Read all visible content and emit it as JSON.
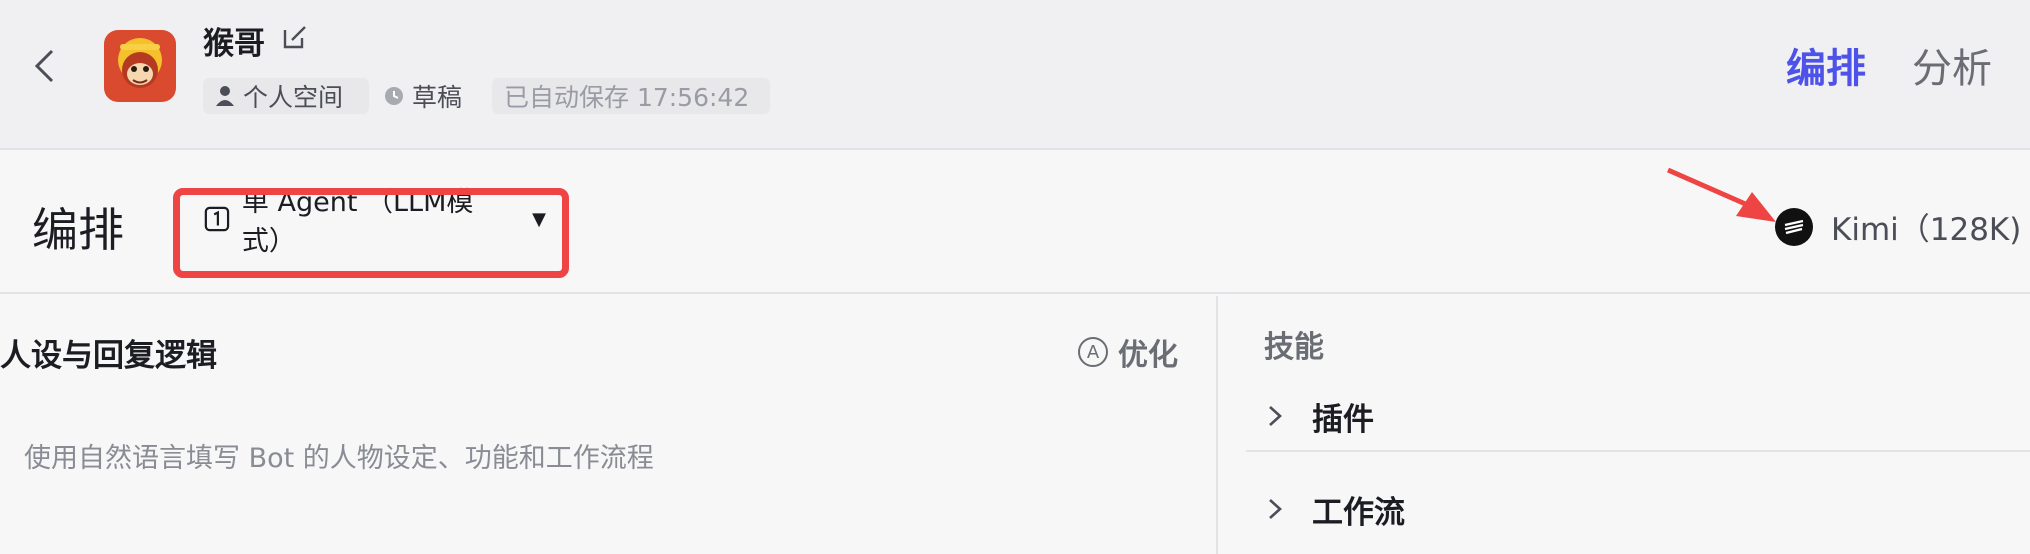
{
  "header": {
    "bot_name": "猴哥",
    "space_label": "个人空间",
    "status_label": "草稿",
    "autosave_text": "已自动保存 17:56:42",
    "tabs": [
      {
        "label": "编排",
        "active": true
      },
      {
        "label": "分析",
        "active": false
      }
    ]
  },
  "toolbar": {
    "section_title": "编排",
    "mode_label": "单 Agent （LLM模式）",
    "model_label": "Kimi（128K)"
  },
  "prompt_panel": {
    "heading": "人设与回复逻辑",
    "optimize_label": "优化",
    "placeholder": "使用自然语言填写 Bot 的人物设定、功能和工作流程"
  },
  "skills_panel": {
    "title": "技能",
    "items": [
      {
        "label": "插件"
      },
      {
        "label": "工作流"
      }
    ]
  },
  "colors": {
    "accent": "#4d53e8",
    "highlight": "#ee4444"
  },
  "icons": [
    "back-arrow-icon",
    "edit-icon",
    "user-icon",
    "clock-icon",
    "agent-mode-icon",
    "caret-down-icon",
    "model-icon",
    "annotation-arrow-icon",
    "optimize-icon",
    "chevron-right-icon"
  ]
}
